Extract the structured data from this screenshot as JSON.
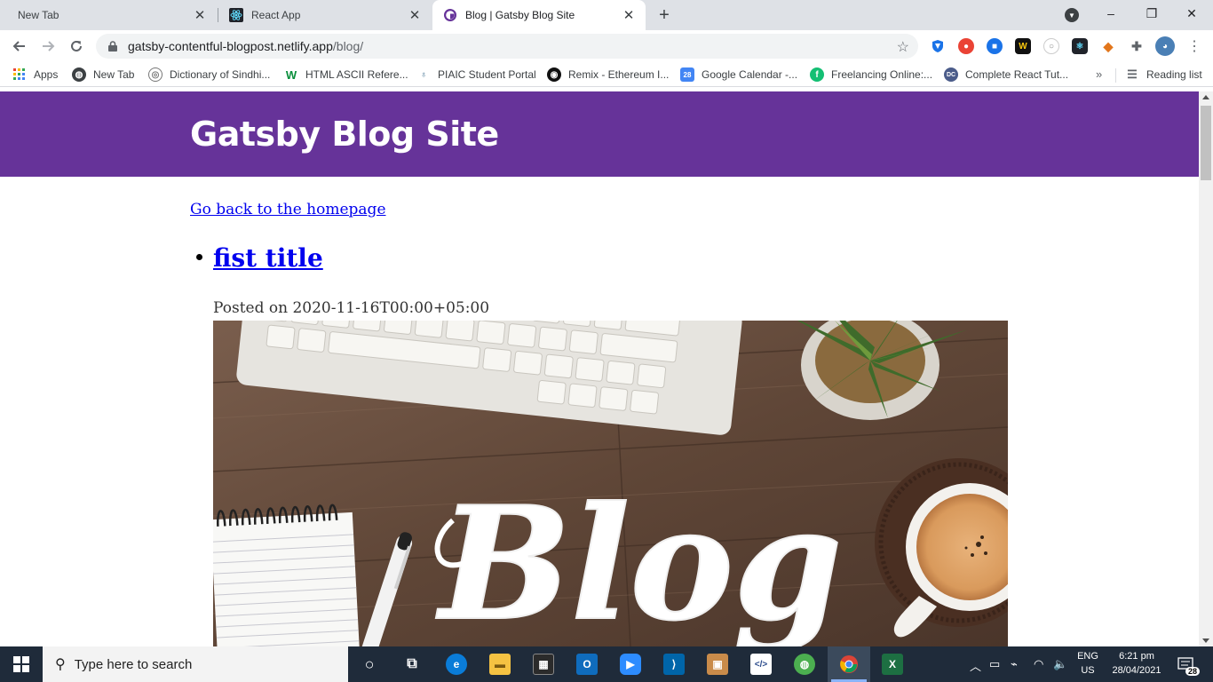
{
  "tabs": [
    {
      "label": "New Tab",
      "favicon": "none",
      "active": false
    },
    {
      "label": "React App",
      "favicon": "react-icon",
      "active": false
    },
    {
      "label": "Blog | Gatsby Blog Site",
      "favicon": "gatsby-icon",
      "active": true
    }
  ],
  "window_controls": {
    "minimize": "–",
    "maximize": "❐",
    "close": "✕"
  },
  "address_bar": {
    "host": "gatsby-contentful-blogpost.netlify.app",
    "path": "/blog/"
  },
  "bookmarks": [
    {
      "label": "Apps"
    },
    {
      "label": "New Tab"
    },
    {
      "label": "Dictionary of Sindhi..."
    },
    {
      "label": "HTML ASCII Refere..."
    },
    {
      "label": "PIAIC Student Portal"
    },
    {
      "label": "Remix - Ethereum I..."
    },
    {
      "label": "Google Calendar -..."
    },
    {
      "label": "Freelancing Online:..."
    },
    {
      "label": "Complete React Tut..."
    }
  ],
  "bookmarks_more": "»",
  "reading_list": "Reading list",
  "page": {
    "site_title": "Gatsby Blog Site",
    "home_link": "Go back to the homepage",
    "posts": [
      {
        "title": "fist title",
        "date": "Posted on 2020-11-16T00:00+05:00",
        "image_word": "Blog"
      }
    ]
  },
  "taskbar": {
    "search_placeholder": "Type here to search",
    "language": "ENG",
    "region": "US",
    "time": "6:21 pm",
    "date": "28/04/2021",
    "notifications": "28"
  },
  "colors": {
    "header_purple": "#663399",
    "link_blue": "#0000ee",
    "taskbar": "#1f2b3a"
  }
}
